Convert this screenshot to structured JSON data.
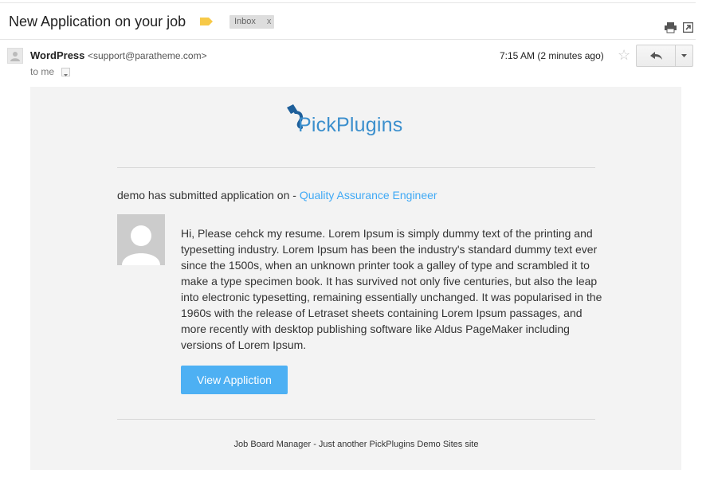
{
  "subject": "New Application on your job",
  "inbox_label": "Inbox",
  "inbox_close": "x",
  "sender": {
    "name": "WordPress",
    "email": "<support@paratheme.com>",
    "to": "to me",
    "time": "7:15 AM (2 minutes ago)"
  },
  "icons": {
    "label_tag": "label-tag-icon",
    "print": "print-icon",
    "popout": "new-window-icon",
    "star": "star-icon",
    "reply": "reply-icon",
    "more": "chevron-down-icon",
    "avatar": "person-icon"
  },
  "colors": {
    "label_tag": "#f7c948",
    "link": "#3fa9f5",
    "button": "#4db0f3",
    "logo": "#3b8fcd",
    "logo_mark": "#1e5f9a",
    "body_bg": "#f3f3f3"
  },
  "email": {
    "logo_text": "PickPlugins",
    "intro_prefix": "demo has submitted application on - ",
    "intro_link": "Quality Assurance Engineer",
    "message": "Hi, Please cehck my resume. Lorem Ipsum is simply dummy text of the printing and typesetting industry. Lorem Ipsum has been the industry's standard dummy text ever since the 1500s, when an unknown printer took a galley of type and scrambled it to make a type specimen book. It has survived not only five centuries, but also the leap into electronic typesetting, remaining essentially unchanged. It was popularised in the 1960s with the release of Letraset sheets containing Lorem Ipsum passages, and more recently with desktop publishing software like Aldus PageMaker including versions of Lorem Ipsum.",
    "button_label": "View Appliction",
    "footer": "Job Board Manager - Just another PickPlugins Demo Sites site"
  }
}
